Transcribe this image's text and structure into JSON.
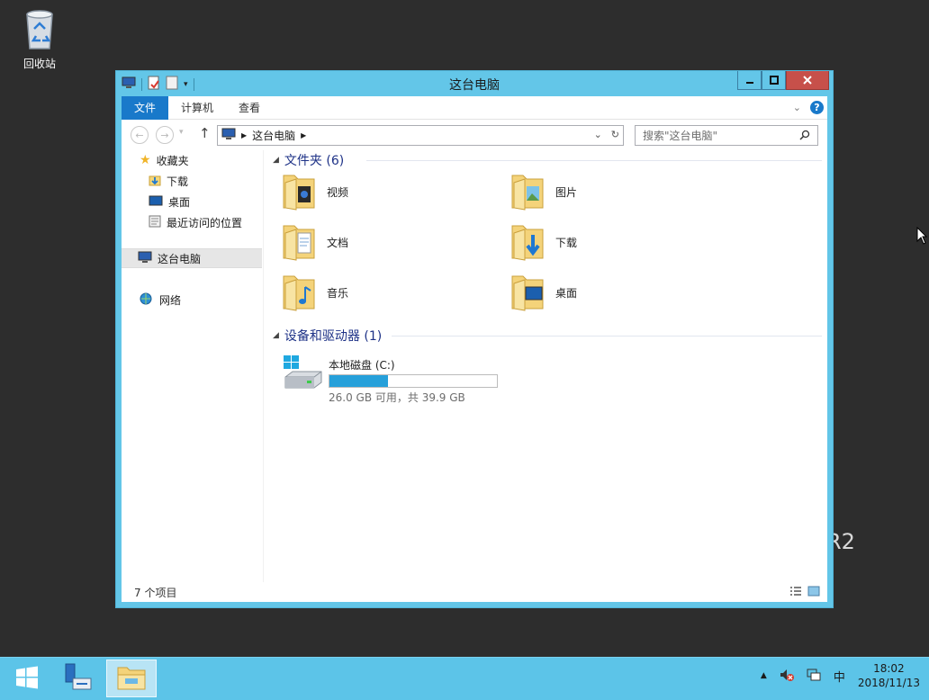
{
  "desktop": {
    "recycle_bin_label": "回收站",
    "watermark": "R2"
  },
  "window": {
    "title": "这台电脑",
    "controls": {
      "minimize": "minimize",
      "maximize": "maximize",
      "close": "close"
    }
  },
  "ribbon": {
    "tabs": [
      {
        "label": "文件"
      },
      {
        "label": "计算机"
      },
      {
        "label": "查看"
      }
    ],
    "help_label": "?"
  },
  "address": {
    "path_item": "这台电脑",
    "search_placeholder": "搜索\"这台电脑\""
  },
  "navpane": {
    "favorites": "收藏夹",
    "downloads": "下载",
    "desktop": "桌面",
    "recent": "最近访问的位置",
    "this_pc": "这台电脑",
    "network": "网络"
  },
  "content": {
    "folders_header": "文件夹 (6)",
    "folders": [
      {
        "label": "视频",
        "icon": "videos-folder-icon"
      },
      {
        "label": "图片",
        "icon": "pictures-folder-icon"
      },
      {
        "label": "文档",
        "icon": "documents-folder-icon"
      },
      {
        "label": "下载",
        "icon": "downloads-folder-icon"
      },
      {
        "label": "音乐",
        "icon": "music-folder-icon"
      },
      {
        "label": "桌面",
        "icon": "desktop-folder-icon"
      }
    ],
    "devices_header": "设备和驱动器 (1)",
    "drive": {
      "label": "本地磁盘 (C:)",
      "free_text": "26.0 GB 可用，共 39.9 GB",
      "used_fraction": 0.35,
      "bar_color": "#26a0da"
    }
  },
  "status": {
    "item_count": "7 个项目"
  },
  "taskbar": {
    "ime": "中",
    "time": "18:02",
    "date": "2018/11/13"
  },
  "colors": {
    "window_frame": "#63c6e8",
    "file_tab": "#1979ca",
    "close_button": "#c7504a",
    "taskbar": "#5cc4e8"
  }
}
